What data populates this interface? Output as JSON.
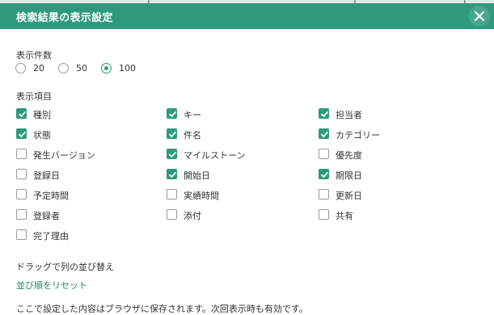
{
  "dialog": {
    "title": "検索結果の表示設定",
    "close_icon": "close-icon",
    "accent_color": "#2e9a7b"
  },
  "count": {
    "label": "表示件数",
    "options": [
      "20",
      "50",
      "100"
    ],
    "selected": "100"
  },
  "items": {
    "label": "表示項目",
    "columns": [
      [
        {
          "label": "種別",
          "checked": true
        },
        {
          "label": "状態",
          "checked": true
        },
        {
          "label": "発生バージョン",
          "checked": false
        },
        {
          "label": "登録日",
          "checked": false
        },
        {
          "label": "予定時間",
          "checked": false
        },
        {
          "label": "登録者",
          "checked": false
        },
        {
          "label": "完了理由",
          "checked": false
        }
      ],
      [
        {
          "label": "キー",
          "checked": true
        },
        {
          "label": "件名",
          "checked": true
        },
        {
          "label": "マイルストーン",
          "checked": true
        },
        {
          "label": "開始日",
          "checked": true
        },
        {
          "label": "実績時間",
          "checked": false
        },
        {
          "label": "添付",
          "checked": false
        }
      ],
      [
        {
          "label": "担当者",
          "checked": true
        },
        {
          "label": "カテゴリー",
          "checked": true
        },
        {
          "label": "優先度",
          "checked": false
        },
        {
          "label": "期限日",
          "checked": true
        },
        {
          "label": "更新日",
          "checked": false
        },
        {
          "label": "共有",
          "checked": false
        }
      ]
    ]
  },
  "reorder": {
    "hint": "ドラッグで列の並び替え",
    "reset_link": "並び順をリセット"
  },
  "footer_note": "ここで設定した内容はブラウザに保存されます。次回表示時も有効です。"
}
